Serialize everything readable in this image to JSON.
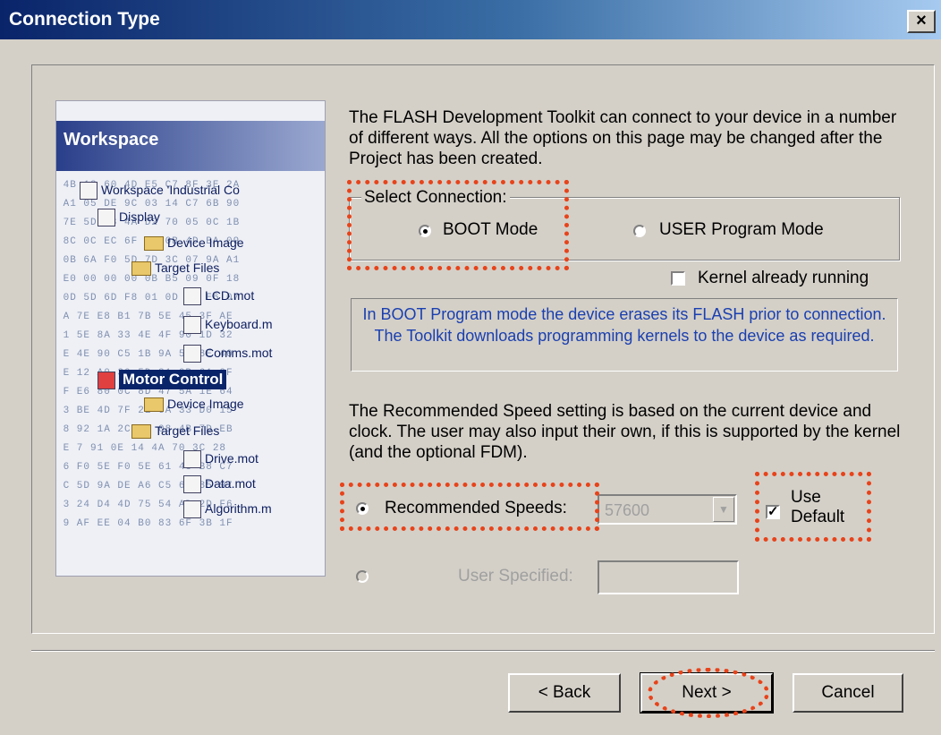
{
  "window": {
    "title": "Connection Type",
    "close_label": "×"
  },
  "illustration": {
    "header": "Workspace",
    "items": [
      "Workspace 'Industrial Co",
      "Display",
      "Device Image",
      "Target Files",
      "LCD.mot",
      "Keyboard.m",
      "Comms.mot",
      "Motor Control",
      "Device Image",
      "Target Files",
      "Drive.mot",
      "Data.mot",
      "Algorithm.m"
    ]
  },
  "intro_text": "The FLASH Development Toolkit can connect to your device in a number of different ways. All the options on this page may be changed after the Project has been created.",
  "select_connection": {
    "legend": "Select Connection:",
    "options": [
      {
        "label": "BOOT Mode",
        "selected": true
      },
      {
        "label": "USER Program Mode",
        "selected": false
      }
    ]
  },
  "kernel_running": {
    "label": "Kernel already running",
    "checked": false
  },
  "info_text": "In BOOT Program mode the device erases its FLASH prior to connection. The Toolkit downloads programming kernels to the device as required.",
  "speed_text": "The Recommended Speed setting is based on the current device and clock. The user may also input their own, if this is supported by the kernel (and the optional FDM).",
  "recommended_speeds": {
    "label": "Recommended Speeds:",
    "value": "57600",
    "selected": true
  },
  "use_default": {
    "label_line1": "Use",
    "label_line2": "Default",
    "checked": true
  },
  "user_specified": {
    "label": "User Specified:",
    "value": ""
  },
  "buttons": {
    "back": "< Back",
    "next": "Next >",
    "cancel": "Cancel"
  },
  "colors": {
    "highlight": "#e8431a",
    "info_text": "#1a3fb0",
    "title_bar": "#0a246a"
  }
}
